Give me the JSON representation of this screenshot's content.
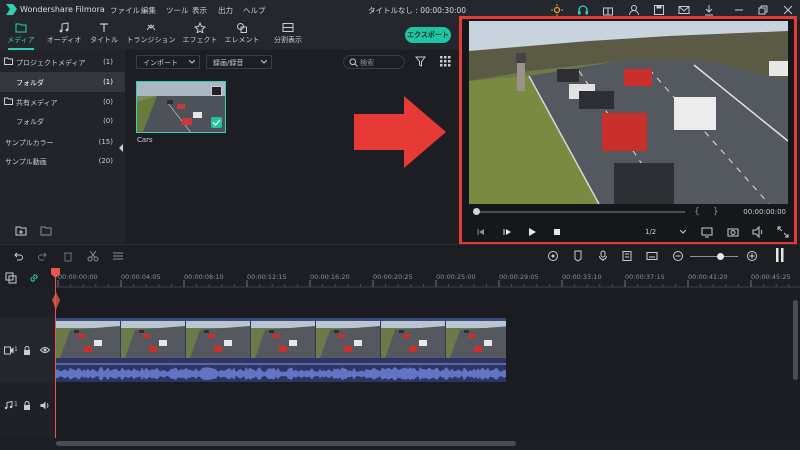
{
  "app": {
    "name": "Wondershare Filmora",
    "menus": [
      "ファイル",
      "編集",
      "ツール",
      "表示",
      "出力",
      "ヘルプ"
    ],
    "doc_title": "タイトルなし : 00:00:30:00"
  },
  "media_tabs": [
    {
      "label": "メディア",
      "icon": "folder-icon",
      "active": true
    },
    {
      "label": "オーディオ",
      "icon": "music-note-icon",
      "active": false
    },
    {
      "label": "タイトル",
      "icon": "text-icon",
      "active": false
    },
    {
      "label": "トランジション",
      "icon": "transition-icon",
      "active": false
    },
    {
      "label": "エフェクト",
      "icon": "effect-icon",
      "active": false
    },
    {
      "label": "エレメント",
      "icon": "element-icon",
      "active": false
    },
    {
      "label": "分割表示",
      "icon": "split-screen-icon",
      "active": false
    }
  ],
  "export_label": "エクスポート",
  "sidebar": {
    "items": [
      {
        "label": "プロジェクトメディア",
        "count": "(1)",
        "folder": true
      },
      {
        "label": "フォルダ",
        "count": "(1)",
        "selected": true
      },
      {
        "label": "共有メディア",
        "count": "(0)",
        "folder": true
      },
      {
        "label": "フォルダ",
        "count": "(0)"
      },
      {
        "label": "サンプルカラー",
        "count": "(15)"
      },
      {
        "label": "サンプル動画",
        "count": "(20)"
      }
    ]
  },
  "media": {
    "import_label": "インポート",
    "record_label": "録画/録音",
    "search_placeholder": "検索",
    "thumb_label": "Cars"
  },
  "preview": {
    "timecode": "00:00:00:00",
    "ratio": "1/2"
  },
  "ruler": [
    "00:00:00:00",
    "00:00:04:05",
    "00:00:08:10",
    "00:00:12:15",
    "00:00:16:20",
    "00:00:20:25",
    "00:00:25:00",
    "00:00:29:05",
    "00:00:33:10",
    "00:00:37:15",
    "00:00:41:20",
    "00:00:45:25"
  ],
  "tracks": {
    "video_num": "1",
    "audio_num": "1"
  },
  "colors": {
    "accent": "#1dc6a1",
    "highlight_border": "#e53a35",
    "playhead": "#e8564e"
  }
}
